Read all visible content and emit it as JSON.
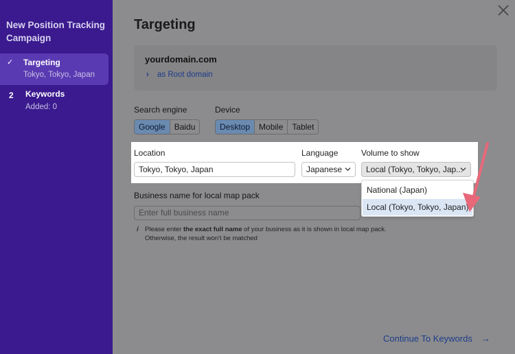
{
  "sidebar": {
    "title": "New Position Tracking Campaign",
    "steps": [
      {
        "marker": "✓",
        "title": "Targeting",
        "sub": "Tokyo, Tokyo, Japan"
      },
      {
        "marker": "2",
        "title": "Keywords",
        "sub": "Added: 0"
      }
    ]
  },
  "main": {
    "title": "Targeting",
    "domain": {
      "name": "yourdomain.com",
      "type_label": "as Root domain"
    },
    "search_engine": {
      "label": "Search engine",
      "options": [
        "Google",
        "Baidu"
      ],
      "selected": "Google"
    },
    "device": {
      "label": "Device",
      "options": [
        "Desktop",
        "Mobile",
        "Tablet"
      ],
      "selected": "Desktop"
    },
    "location": {
      "label": "Location",
      "value": "Tokyo, Tokyo, Japan"
    },
    "language": {
      "label": "Language",
      "value": "Japanese"
    },
    "volume": {
      "label": "Volume to show",
      "value": "Local (Tokyo, Tokyo, Japan)",
      "value_truncated": "Local (Tokyo, Tokyo, Jap...",
      "options": [
        "National (Japan)",
        "Local (Tokyo, Tokyo, Japan)"
      ]
    },
    "business": {
      "label": "Business name for local map pack",
      "placeholder": "Enter full business name",
      "hint_pre": "Please enter ",
      "hint_bold": "the exact full name",
      "hint_post": " of your business as it is shown in local map pack. Otherwise, the result won't be matched"
    },
    "continue_label": "Continue To Keywords",
    "continue_arrow": "→"
  },
  "colors": {
    "sidebar_bg": "#3a1a8e",
    "accent": "#1d3c8a",
    "annotation_arrow": "#e8687a"
  }
}
